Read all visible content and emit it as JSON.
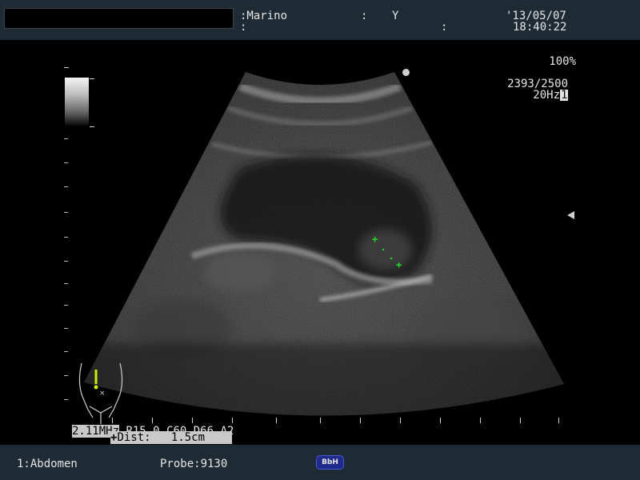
{
  "header": {
    "patient_field": ":Marino",
    "sep_colon_1": ":",
    "sex_value": "Y",
    "date": "'13/05/07",
    "row2_colon_1": ":",
    "row2_colon_2": ":",
    "time": "18:40:22"
  },
  "display": {
    "zoom": "100%",
    "frame_counter": "2393/2500",
    "frame_rate": "20Hz",
    "frame_rate_index": "1"
  },
  "params": {
    "freq_highlight": "2.11MHz",
    "rest": "R15 0 C60 D66 A2"
  },
  "measurement": {
    "caliper_glyph": "+",
    "cursor_glyph": "+",
    "dist_label": "Dist:",
    "dist_value": "1.5cm",
    "caliper_color": "#22e022"
  },
  "footer": {
    "preset": "1:Abdomen",
    "probe": "Probe:9130",
    "badge": "BbH"
  },
  "colors": {
    "bar_background": "#1e2a34",
    "badge_background": "#202a8a"
  }
}
